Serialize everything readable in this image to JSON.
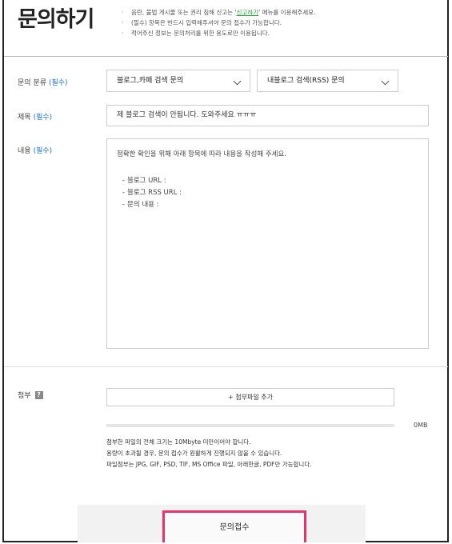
{
  "header": {
    "title": "문의하기",
    "notices": [
      {
        "pre": "음란, 불법 게시물 또는 권리 침해 신고는 '",
        "link": "신고하기",
        "post": "' 메뉴를 이용해주세요."
      },
      {
        "pre": "(필수) 항목은 반드시 입력해주셔야 문의 접수가 가능합니다.",
        "link": "",
        "post": ""
      },
      {
        "pre": "적어주신 정보는 문의처리를 위한 용도로만 이용됩니다.",
        "link": "",
        "post": ""
      }
    ]
  },
  "form": {
    "required_tag": "(필수)",
    "category": {
      "label": "문의 분류",
      "primary_value": "블로그,카페 검색 문의",
      "secondary_value": "내블로그 검색(RSS) 문의"
    },
    "subject": {
      "label": "제목",
      "value": "제 블로그 검색이 안됩니다. 도와주세요 ㅠㅠㅠ"
    },
    "content": {
      "label": "내용",
      "guide": "정확한 확인을 위해 아래 항목에 따라 내용을 작성해 주세요.",
      "lines": [
        "블로그 URL :",
        "블로그 RSS URL :",
        "문의 내용 :"
      ]
    },
    "attachment": {
      "label": "첨부",
      "help_icon": "?",
      "add_button": "+ 첨부파일 추가",
      "size_label": "0MB",
      "progress_fraction": 0,
      "notes": [
        "첨부한 파일의 전체 크기는 10Mbyte 미만이어야 합니다.",
        "용량이 초과될 경우, 문의 접수가 원활하게 진행되지 않을 수 있습니다.",
        "파일첨부는 JPG, GIF, PSD, TIF, MS Office 파일, 아래한글, PDF만 가능합니다."
      ]
    }
  },
  "footer": {
    "submit_label": "문의접수"
  },
  "colors": {
    "required_blue": "#1a73c8",
    "link_green": "#2ba33e",
    "highlight_pink": "#e8336d"
  }
}
